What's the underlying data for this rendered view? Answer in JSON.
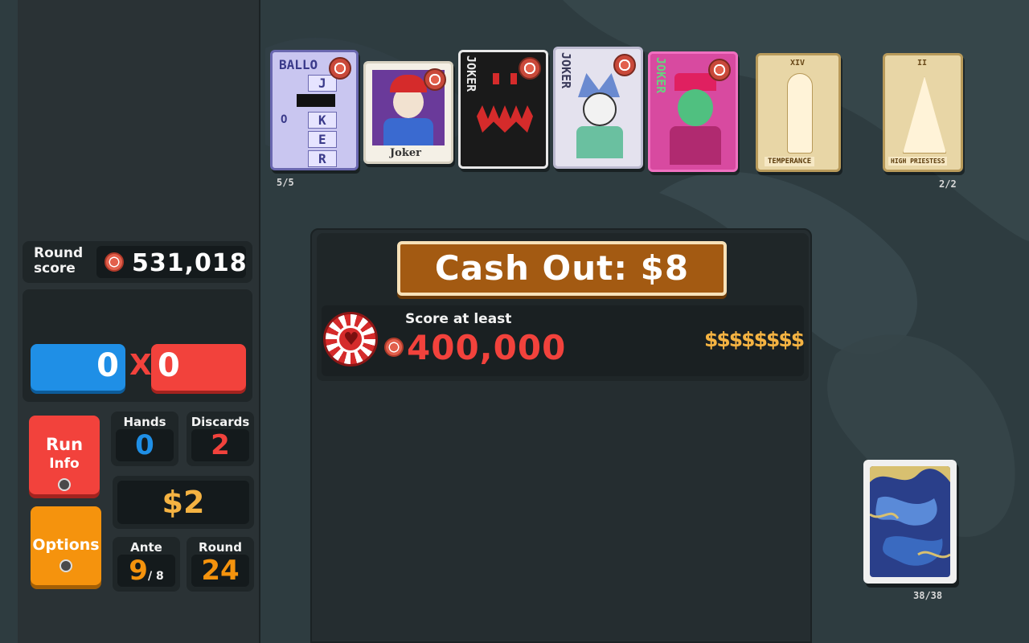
{
  "jokers": {
    "count": "5/5",
    "cards": [
      {
        "name": "Ballot Joker",
        "text": [
          "BALLO",
          "J",
          "O",
          "K",
          "E",
          "R"
        ]
      },
      {
        "name": "Joker",
        "caption": "Joker"
      },
      {
        "name": "Scary Joker",
        "text": "JOKER"
      },
      {
        "name": "Classic Joker",
        "text": "JOKER"
      },
      {
        "name": "Sad Clown Joker",
        "text": "JOKER"
      }
    ]
  },
  "consumables": {
    "count": "2/2",
    "cards": [
      {
        "name": "Temperance",
        "numeral": "XIV",
        "caption": "TEMPERANCE"
      },
      {
        "name": "High Priestess",
        "numeral": "II",
        "caption": "HIGH PRIESTESS"
      }
    ]
  },
  "round_score": {
    "label_line1": "Round",
    "label_line2": "score",
    "value": "531,018"
  },
  "hand": {
    "chips": "0",
    "times": "X",
    "mult": "0"
  },
  "run_info_button": {
    "line1": "Run",
    "line2": "Info"
  },
  "options_button": {
    "label": "Options"
  },
  "hands": {
    "label": "Hands",
    "value": "0"
  },
  "discards": {
    "label": "Discards",
    "value": "2"
  },
  "money": "$2",
  "ante": {
    "label": "Ante",
    "value": "9",
    "max": "/ 8"
  },
  "round": {
    "label": "Round",
    "value": "24"
  },
  "cash_out": {
    "button_label": "Cash Out: $8",
    "requirement_label": "Score at least",
    "target": "400,000",
    "reward": "$$$$$$$$"
  },
  "deck": {
    "count": "38/38"
  },
  "colors": {
    "chips_blue": "#1f8fe6",
    "mult_red": "#f2423c",
    "money_gold": "#f5b342",
    "options_orange": "#f5930d",
    "cashout_brown": "#a35a12"
  }
}
